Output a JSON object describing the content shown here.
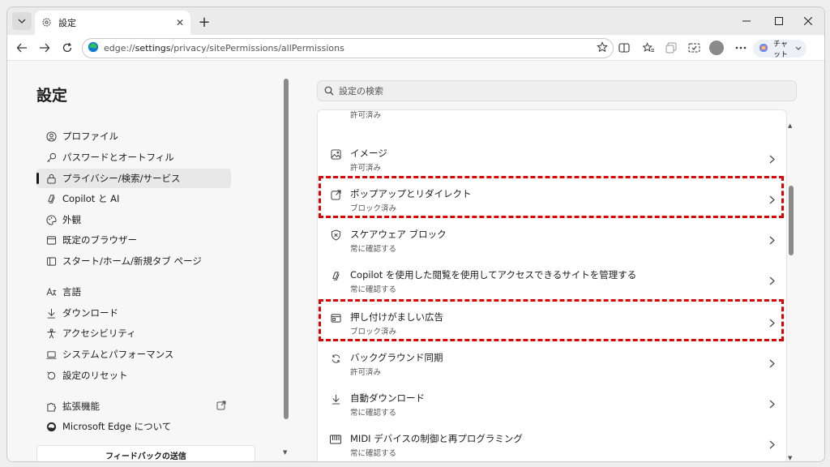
{
  "browser": {
    "tab_title": "設定",
    "url_prefix": "edge://",
    "url_path": "settings",
    "url_rest": "/privacy/sitePermissions/allPermissions",
    "chat_label": "チャット",
    "icons": [
      "tab-actions-icon",
      "settings-gear-icon",
      "close-icon",
      "plus-icon",
      "minimize-icon",
      "maximize-icon",
      "back-icon",
      "forward-icon",
      "refresh-icon",
      "edge-icon",
      "favorite-star-icon",
      "split-screen-icon",
      "favorites-icon",
      "collections-icon",
      "screenshot-icon",
      "profile-icon",
      "more-icon",
      "copilot-icon"
    ]
  },
  "sidebar": {
    "title": "設定",
    "items": [
      {
        "label": "プロファイル",
        "icon": "profile-icon"
      },
      {
        "label": "パスワードとオートフィル",
        "icon": "key-icon"
      },
      {
        "label": "プライバシー/検索/サービス",
        "icon": "lock-icon",
        "active": true
      },
      {
        "label": "Copilot と AI",
        "icon": "copilot-icon"
      },
      {
        "label": "外観",
        "icon": "palette-icon"
      },
      {
        "label": "既定のブラウザー",
        "icon": "browser-icon"
      },
      {
        "label": "スタート/ホーム/新規タブ ページ",
        "icon": "home-page-icon"
      },
      {
        "label": "言語",
        "icon": "language-icon"
      },
      {
        "label": "ダウンロード",
        "icon": "download-icon"
      },
      {
        "label": "アクセシビリティ",
        "icon": "accessibility-icon"
      },
      {
        "label": "システムとパフォーマンス",
        "icon": "laptop-icon"
      },
      {
        "label": "設定のリセット",
        "icon": "reset-icon"
      },
      {
        "label": "拡張機能",
        "icon": "extensions-icon"
      },
      {
        "label": "Microsoft Edge について",
        "icon": "edge-icon"
      }
    ],
    "feedback_label": "フィードバックの送信"
  },
  "main": {
    "search_placeholder": "設定の検索",
    "partial_sub": "許可済み",
    "rows": [
      {
        "title": "イメージ",
        "sub": "許可済み",
        "icon": "image-icon"
      },
      {
        "title": "ポップアップとリダイレクト",
        "sub": "ブロック済み",
        "icon": "popup-icon",
        "highlighted": true
      },
      {
        "title": "スケアウェア ブロック",
        "sub": "常に確認する",
        "icon": "shield-icon"
      },
      {
        "title": "Copilot を使用した閲覧を使用してアクセスできるサイトを管理する",
        "sub": "常に確認する",
        "icon": "copilot-icon"
      },
      {
        "title": "押し付けがましい広告",
        "sub": "ブロック済み",
        "icon": "ad-icon",
        "highlighted": true
      },
      {
        "title": "バックグラウンド同期",
        "sub": "許可済み",
        "icon": "sync-icon"
      },
      {
        "title": "自動ダウンロード",
        "sub": "常に確認する",
        "icon": "download-icon"
      },
      {
        "title": "MIDI デバイスの制御と再プログラミング",
        "sub": "常に確認する",
        "icon": "midi-icon"
      }
    ]
  },
  "colors": {
    "highlight": "#e00000",
    "edge_blue": "#0c7bd6",
    "edge_green": "#35c159"
  }
}
